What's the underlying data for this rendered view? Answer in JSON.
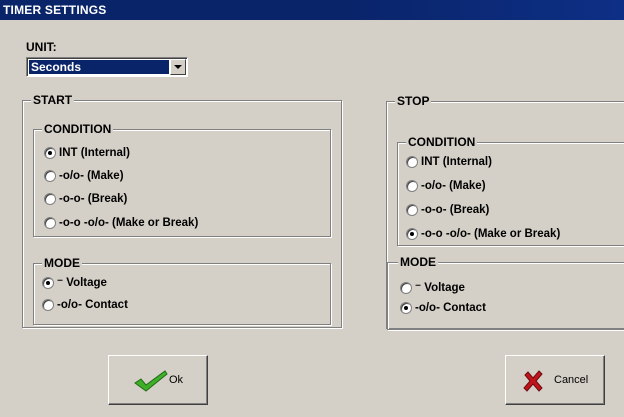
{
  "window": {
    "title": "TIMER SETTINGS"
  },
  "unit": {
    "label": "UNIT:",
    "selected": "Seconds"
  },
  "start": {
    "title": "START",
    "condition": {
      "title": "CONDITION",
      "options": [
        {
          "label": "INT  (Internal)",
          "checked": true
        },
        {
          "label": "-o/o-  (Make)",
          "checked": false
        },
        {
          "label": "-o-o-  (Break)",
          "checked": false
        },
        {
          "label": "-o-o -o/o-  (Make or Break)",
          "checked": false
        }
      ]
    },
    "mode": {
      "title": "MODE",
      "options": [
        {
          "label": "⁻ Voltage",
          "checked": true
        },
        {
          "label": "-o/o-  Contact",
          "checked": false
        }
      ]
    }
  },
  "stop": {
    "title": "STOP",
    "condition": {
      "title": "CONDITION",
      "options": [
        {
          "label": "INT  (Internal)",
          "checked": false
        },
        {
          "label": "-o/o-  (Make)",
          "checked": false
        },
        {
          "label": "-o-o-  (Break)",
          "checked": false
        },
        {
          "label": "-o-o -o/o-  (Make or Break)",
          "checked": true
        }
      ]
    },
    "mode": {
      "title": "MODE",
      "options": [
        {
          "label": "⁻ Voltage",
          "checked": false
        },
        {
          "label": "-o/o-  Contact",
          "checked": true
        }
      ]
    }
  },
  "buttons": {
    "ok": {
      "label": "Ok",
      "icon": "check-icon",
      "color": "#3fae2a"
    },
    "cancel": {
      "label": "Cancel",
      "icon": "x-icon",
      "color": "#c0141c"
    }
  }
}
